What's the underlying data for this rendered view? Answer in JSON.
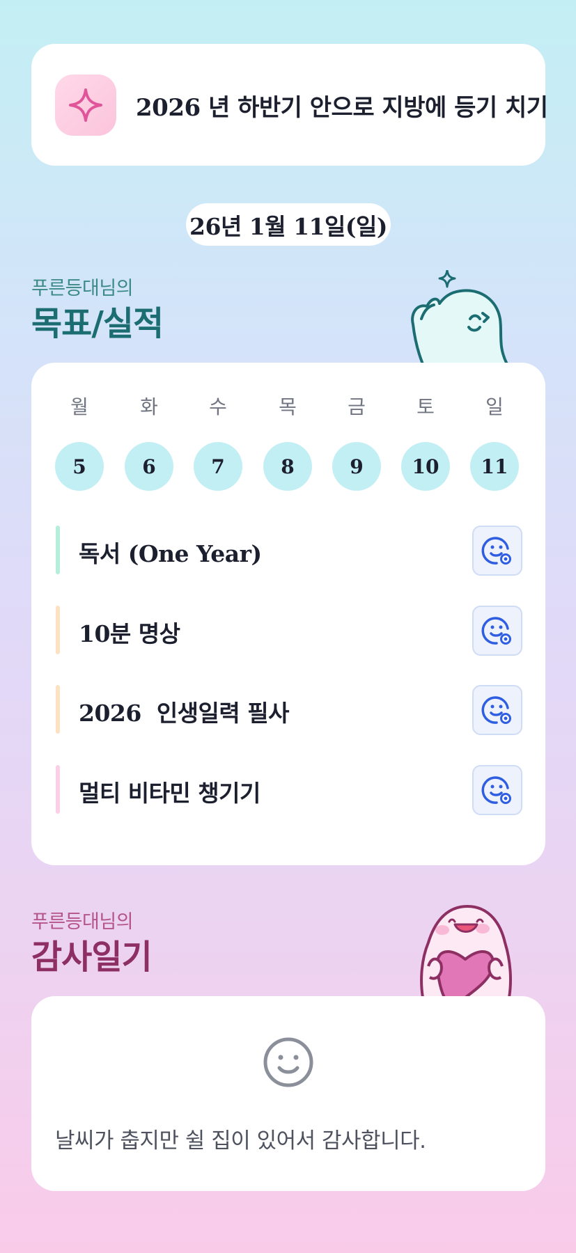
{
  "goal": {
    "text": "2026 년 하반기 안으로 지방에 등기 치기",
    "icon": "sparkle-icon"
  },
  "date": "26년 1월 11일(일)",
  "goals_section": {
    "subtitle": "푸른등대님의",
    "title": "목표/실적"
  },
  "week": {
    "weekdays": [
      "월",
      "화",
      "수",
      "목",
      "금",
      "토",
      "일"
    ],
    "days": [
      "5",
      "6",
      "7",
      "8",
      "9",
      "10",
      "11"
    ]
  },
  "tasks": [
    {
      "label": "독서 (One Year)",
      "color": "#b5eedb",
      "icon": "smile-add-icon"
    },
    {
      "label": "10분 명상",
      "color": "#fde1c3",
      "icon": "smile-add-icon"
    },
    {
      "label": "2026  인생일력 필사",
      "color": "#fde1c3",
      "icon": "smile-add-icon"
    },
    {
      "label": "멀티 비타민 챙기기",
      "color": "#fbd0e6",
      "icon": "smile-add-icon"
    }
  ],
  "thanks_section": {
    "subtitle": "푸른등대님의",
    "title": "감사일기"
  },
  "thanks": {
    "icon": "smile-icon",
    "text": "날씨가 춥지만 쉴 집이 있어서 감사합니다."
  },
  "colors": {
    "accent_teal": "#1b6d72",
    "accent_pink": "#8e2f63",
    "day_circle": "#c2eff4",
    "button_blue": "#2f5fe0"
  }
}
